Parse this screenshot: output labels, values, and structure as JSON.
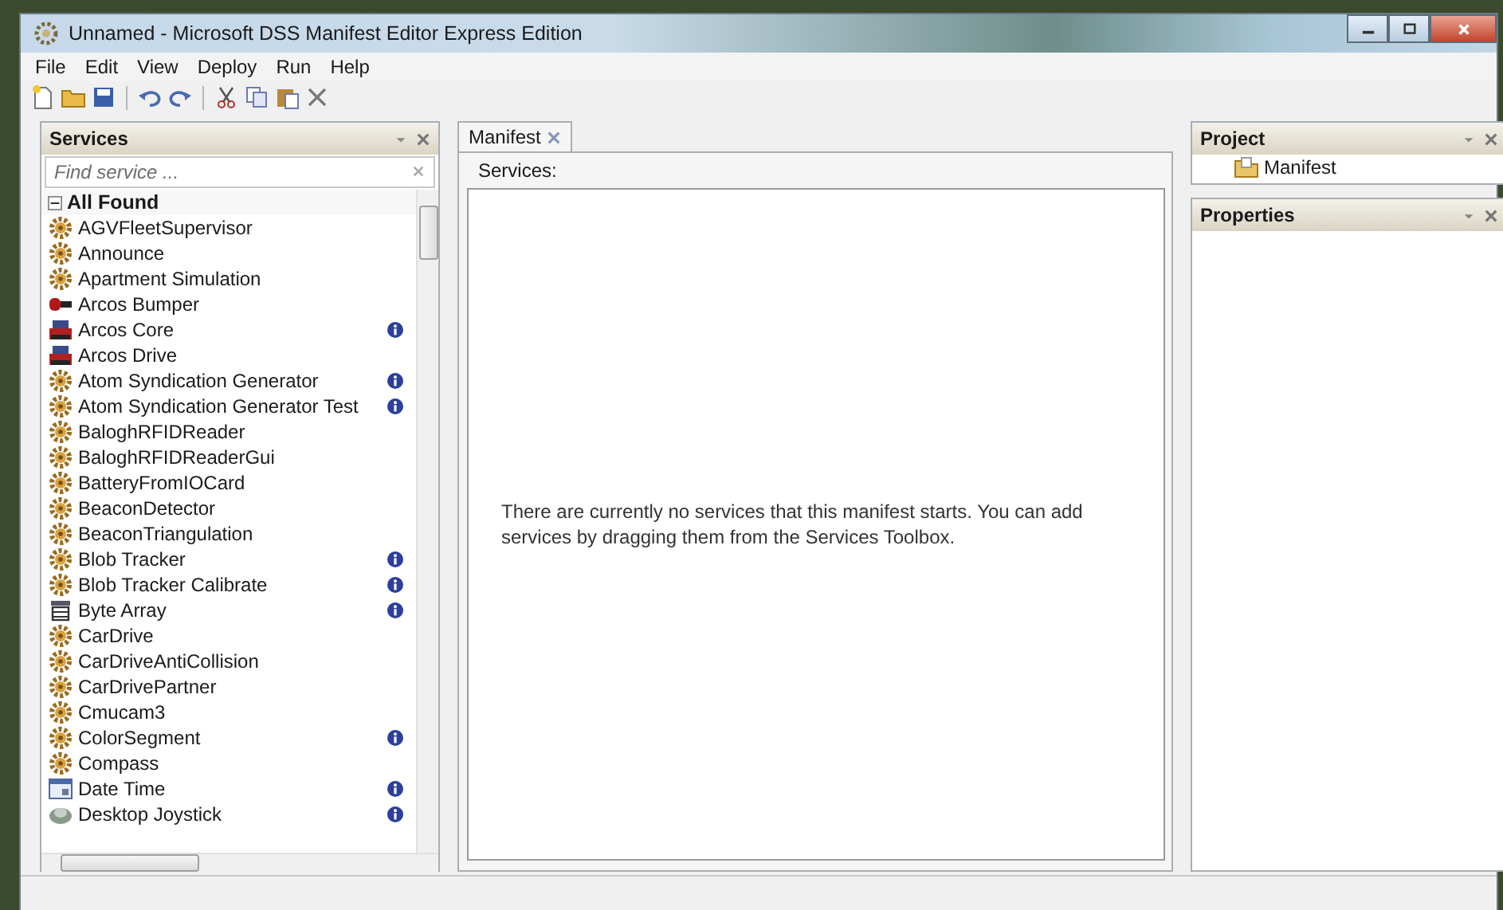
{
  "window": {
    "title": "Unnamed - Microsoft DSS Manifest Editor Express Edition"
  },
  "menu": [
    "File",
    "Edit",
    "View",
    "Deploy",
    "Run",
    "Help"
  ],
  "services_panel": {
    "title": "Services",
    "search": {
      "placeholder": "Find service ..."
    },
    "group": {
      "label": "All Found",
      "expanded": true,
      "children": [
        {
          "label": "AGVFleetSupervisor",
          "kind": "gear",
          "info": false
        },
        {
          "label": "Announce",
          "kind": "gear",
          "info": false
        },
        {
          "label": "Apartment Simulation",
          "kind": "gear",
          "info": false
        },
        {
          "label": "Arcos Bumper",
          "kind": "bumper",
          "info": false
        },
        {
          "label": "Arcos Core",
          "kind": "robot",
          "info": true
        },
        {
          "label": "Arcos Drive",
          "kind": "robot",
          "info": false
        },
        {
          "label": "Atom Syndication Generator",
          "kind": "gear",
          "info": true
        },
        {
          "label": "Atom Syndication Generator Test",
          "kind": "gear",
          "info": true
        },
        {
          "label": "BaloghRFIDReader",
          "kind": "gear",
          "info": false
        },
        {
          "label": "BaloghRFIDReaderGui",
          "kind": "gear",
          "info": false
        },
        {
          "label": "BatteryFromIOCard",
          "kind": "gear",
          "info": false
        },
        {
          "label": "BeaconDetector",
          "kind": "gear",
          "info": false
        },
        {
          "label": "BeaconTriangulation",
          "kind": "gear",
          "info": false
        },
        {
          "label": "Blob Tracker",
          "kind": "gear",
          "info": true
        },
        {
          "label": "Blob Tracker Calibrate",
          "kind": "gear",
          "info": true
        },
        {
          "label": "Byte Array",
          "kind": "bytes",
          "info": true
        },
        {
          "label": "CarDrive",
          "kind": "gear",
          "info": false
        },
        {
          "label": "CarDriveAntiCollision",
          "kind": "gear",
          "info": false
        },
        {
          "label": "CarDrivePartner",
          "kind": "gear",
          "info": false
        },
        {
          "label": "Cmucam3",
          "kind": "gear",
          "info": false
        },
        {
          "label": "ColorSegment",
          "kind": "gear",
          "info": true
        },
        {
          "label": "Compass",
          "kind": "gear",
          "info": false
        },
        {
          "label": "Date Time",
          "kind": "calendar",
          "info": true
        },
        {
          "label": "Desktop Joystick",
          "kind": "joystick",
          "info": true
        }
      ]
    }
  },
  "document_tabs": [
    {
      "label": "Manifest",
      "selected": true
    }
  ],
  "manifest": {
    "label": "Services:",
    "empty_message": "There are currently no services that this manifest starts. You can add services by dragging them from the Services Toolbox."
  },
  "project_panel": {
    "title": "Project",
    "items": [
      {
        "label": "Manifest"
      }
    ]
  },
  "properties_panel": {
    "title": "Properties"
  }
}
